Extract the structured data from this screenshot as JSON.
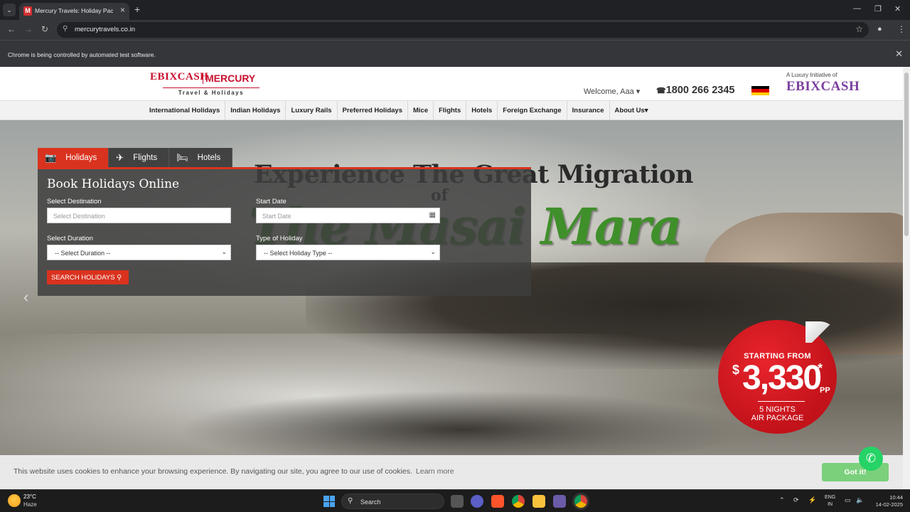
{
  "browser": {
    "tab_title": "Mercury Travels: Holiday Packages",
    "tab_favicon": "M",
    "url": "mercurytravels.co.in",
    "automation_notice": "Chrome is being controlled by automated test software."
  },
  "header": {
    "logo_ebix": "EBIXCASH",
    "logo_mercury": "MERCURY",
    "logo_sub": "Travel & Holidays",
    "welcome": "Welcome, Aaa",
    "phone": "1800 266 2345",
    "luxury_text": "A Luxury Initiative of",
    "ebix_brand": "EBIXCASH"
  },
  "nav": {
    "items": [
      "International Holidays",
      "Indian Holidays",
      "Luxury Rails",
      "Preferred Holidays",
      "Mice",
      "Flights",
      "Hotels",
      "Foreign Exchange",
      "Insurance",
      "About Us"
    ]
  },
  "booking": {
    "tabs": [
      "Holidays",
      "Flights",
      "Hotels"
    ],
    "heading": "Book Holidays Online",
    "destination_label": "Select Destination",
    "destination_placeholder": "Select Destination",
    "start_date_label": "Start Date",
    "start_date_placeholder": "Start Date",
    "duration_label": "Select Duration",
    "duration_value": "-- Select Duration --",
    "holiday_type_label": "Type of Holiday",
    "holiday_type_value": "-- Select Holiday Type --",
    "search_button": "SEARCH HOLIDAYS"
  },
  "hero": {
    "title": "Experience The Great Migration",
    "of": "of",
    "script": "The Masai Mara"
  },
  "promo": {
    "starting_from": "STARTING FROM",
    "currency": "$",
    "price": "3,330",
    "asterisk": "*",
    "per": "PP",
    "nights": "5 NIGHTS",
    "package": "AIR PACKAGE"
  },
  "cookie": {
    "text": "This website uses cookies to enhance your browsing experience. By navigating our site, you agree to our use of cookies.",
    "link": "Learn more",
    "button": "Got it!"
  },
  "taskbar": {
    "temp": "23°C",
    "weather": "Haze",
    "search": "Search",
    "lang1": "ENG",
    "lang2": "IN",
    "time": "10:44",
    "date": "14-02-2025"
  },
  "colors": {
    "accent_red": "#d9331f",
    "brand_red": "#c8102e",
    "promo_red": "#e8242c",
    "ebix_purple": "#7b3fa0",
    "cookie_green": "#7bd07b",
    "whatsapp_green": "#25d366"
  }
}
